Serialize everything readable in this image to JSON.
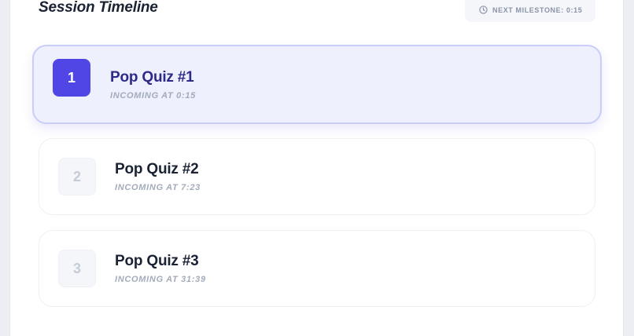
{
  "header": {
    "title": "Session Timeline",
    "milestone_label": "NEXT MILESTONE: 0:15"
  },
  "quizzes": [
    {
      "number": "1",
      "title": "Pop Quiz #1",
      "subtitle": "INCOMING AT 0:15",
      "active": true
    },
    {
      "number": "2",
      "title": "Pop Quiz #2",
      "subtitle": "INCOMING AT 7:23",
      "active": false
    },
    {
      "number": "3",
      "title": "Pop Quiz #3",
      "subtitle": "INCOMING AT 31:39",
      "active": false
    }
  ],
  "colors": {
    "accent": "#4f46e5",
    "active_bg": "#eef0fd",
    "text_dark": "#1a2233",
    "text_muted": "#a3abbb"
  },
  "icons": {
    "milestone": "clock-icon"
  }
}
